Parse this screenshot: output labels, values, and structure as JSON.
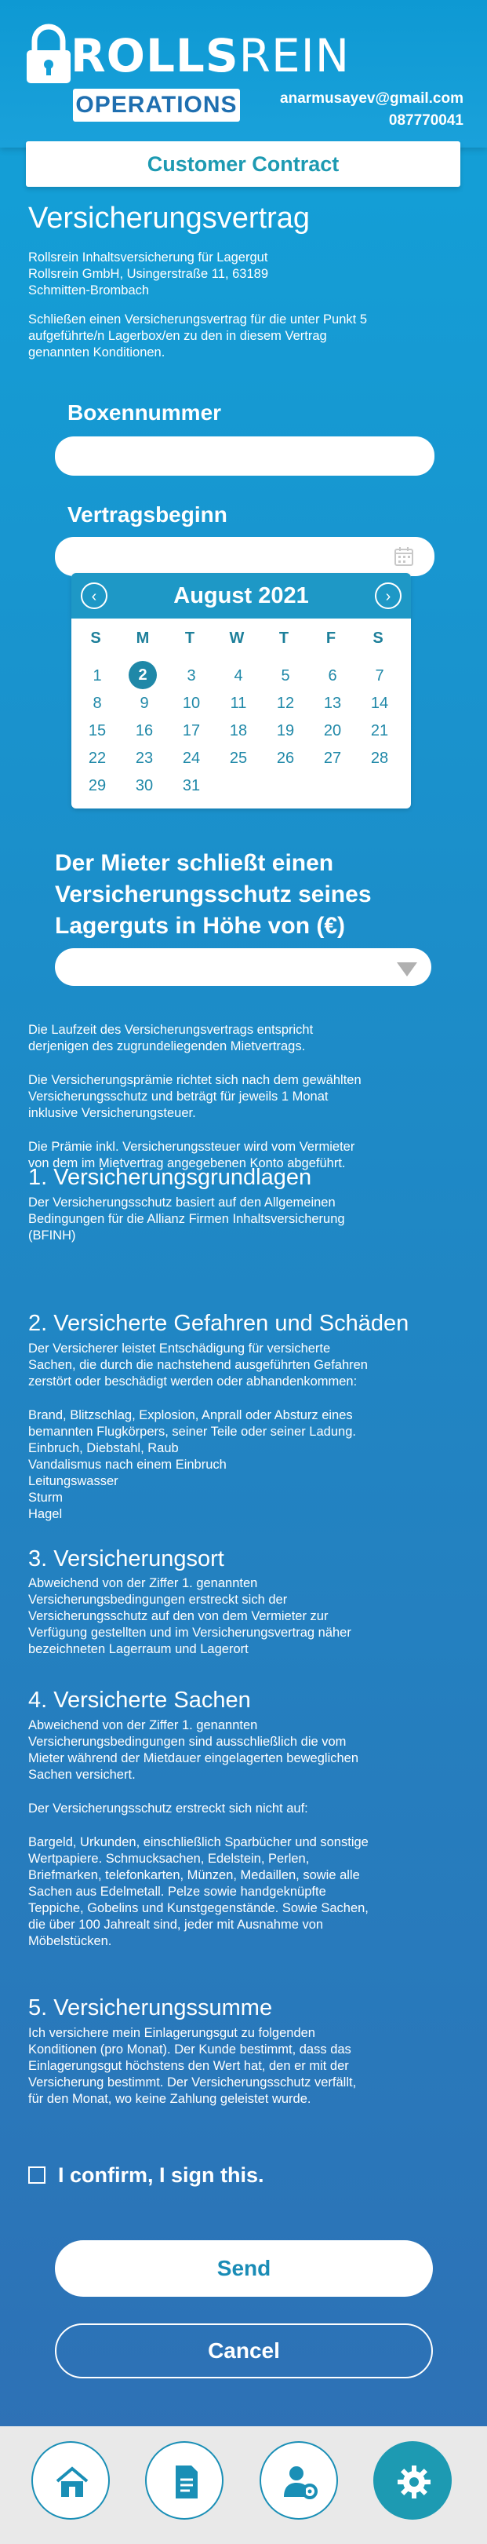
{
  "header": {
    "logo_main": "ROLLS",
    "logo_light": "REIN",
    "badge": "OPERATIONS",
    "email": "anarmusayev@gmail.com",
    "phone": "087770041"
  },
  "title_bar": "Customer Contract",
  "page_heading": "Versicherungsvertrag",
  "intro": {
    "line1": "Rollsrein Inhaltsversicherung für Lagergut",
    "line2": "Rollsrein GmbH, Usingerstraße 11, 63189",
    "line3": "Schmitten-Brombach",
    "line4": "Schließen einen Versicherungsvertrag für die unter Punkt 5",
    "line5": "aufgeführte/n Lagerbox/en zu den in diesem Vertrag",
    "line6": "genannten Konditionen."
  },
  "fields": {
    "box_label": "Boxennummer",
    "box_value": "",
    "start_label": "Vertragsbeginn",
    "start_value": ""
  },
  "calendar": {
    "month_label": "August 2021",
    "weekdays": [
      "S",
      "M",
      "T",
      "W",
      "T",
      "F",
      "S"
    ],
    "selected_day": "2",
    "days": [
      [
        "1",
        "2",
        "3",
        "4",
        "5",
        "6",
        "7"
      ],
      [
        "8",
        "9",
        "10",
        "11",
        "12",
        "13",
        "14"
      ],
      [
        "15",
        "16",
        "17",
        "18",
        "19",
        "20",
        "21"
      ],
      [
        "22",
        "23",
        "24",
        "25",
        "26",
        "27",
        "28"
      ],
      [
        "29",
        "30",
        "31",
        "",
        "",
        "",
        ""
      ]
    ]
  },
  "question": {
    "line1": "Der Mieter schließt einen",
    "line2": "Versicherungsschutz seines",
    "line3": "Lagerguts in Höhe von (€)"
  },
  "amount_select": "",
  "body": {
    "p1a": "Die Laufzeit des Versicherungsvertrags entspricht",
    "p1b": "derjenigen des zugrundeliegenden Mietvertrags.",
    "p2a": "Die Versicherungsprämie richtet sich nach dem gewählten",
    "p2b": "Versicherungsschutz und beträgt für jeweils 1 Monat",
    "p2c": "inklusive Versicherungsteuer.",
    "p3a": "Die Prämie inkl. Versicherungssteuer wird vom Vermieter",
    "p3b": "von dem im Mietvertrag angegebenen Konto abgeführt."
  },
  "sections": {
    "s1_head": "1. Versicherungsgrundlagen",
    "s1_l1": "Der Versicherungsschutz basiert auf den Allgemeinen",
    "s1_l2": "Bedingungen für die Allianz Firmen Inhaltsversicherung",
    "s1_l3": "(BFINH)",
    "s2_head": "2. Versicherte Gefahren und Schäden",
    "s2_l1": "Der Versicherer leistet Entschädigung für versicherte",
    "s2_l2": "Sachen, die durch die nachstehend ausgeführten Gefahren",
    "s2_l3": "zerstört oder beschädigt werden oder abhandenkommen:",
    "s2_l4": "Brand, Blitzschlag, Explosion, Anprall oder Absturz eines",
    "s2_l5": "bemannten Flugkörpers, seiner Teile oder seiner Ladung.",
    "s2_l6": "Einbruch, Diebstahl, Raub",
    "s2_l7": "Vandalismus nach einem Einbruch",
    "s2_l8": "Leitungswasser",
    "s2_l9": "Sturm",
    "s2_l10": "Hagel",
    "s3_head": "3. Versicherungsort",
    "s3_l1": "Abweichend von der Ziffer 1. genannten",
    "s3_l2": "Versicherungsbedingungen erstreckt sich der",
    "s3_l3": "Versicherungsschutz auf den von dem Vermieter zur",
    "s3_l4": "Verfügung gestellten und im Versicherungsvertrag näher",
    "s3_l5": "bezeichneten Lagerraum und Lagerort",
    "s4_head": "4. Versicherte Sachen",
    "s4_l1": "Abweichend von der Ziffer 1. genannten",
    "s4_l2": "Versicherungsbedingungen sind ausschließlich die vom",
    "s4_l3": "Mieter während der Mietdauer eingelagerten beweglichen",
    "s4_l4": "Sachen versichert.",
    "s4_l5": "Der Versicherungsschutz erstreckt sich nicht auf:",
    "s4_l6": "Bargeld, Urkunden, einschließlich Sparbücher und sonstige",
    "s4_l7": "Wertpapiere. Schmucksachen, Edelstein, Perlen,",
    "s4_l8": "Briefmarken, telefonkarten, Münzen, Medaillen, sowie alle",
    "s4_l9": "Sachen aus Edelmetall. Pelze sowie handgeknüpfte",
    "s4_l10": "Teppiche, Gobelins und Kunstgegenstände. Sowie Sachen,",
    "s4_l11": "die über 100 Jahrealt sind, jeder mit Ausnahme von",
    "s4_l12": "Möbelstücken.",
    "s5_head": "5. Versicherungssumme",
    "s5_l1": "Ich versichere mein Einlagerungsgut zu folgenden",
    "s5_l2": "Konditionen (pro Monat). Der Kunde bestimmt, dass das",
    "s5_l3": "Einlagerungsgut höchstens den Wert hat, den er mit der",
    "s5_l4": "Versicherung bestimmt. Der Versicherungsschutz verfällt,",
    "s5_l5": "für den Monat, wo keine Zahlung geleistet wurde."
  },
  "confirm_label": "I confirm, I sign this.",
  "buttons": {
    "send": "Send",
    "cancel": "Cancel"
  },
  "bottom_nav": [
    "home-icon",
    "document-icon",
    "user-settings-icon",
    "gear-icon"
  ]
}
